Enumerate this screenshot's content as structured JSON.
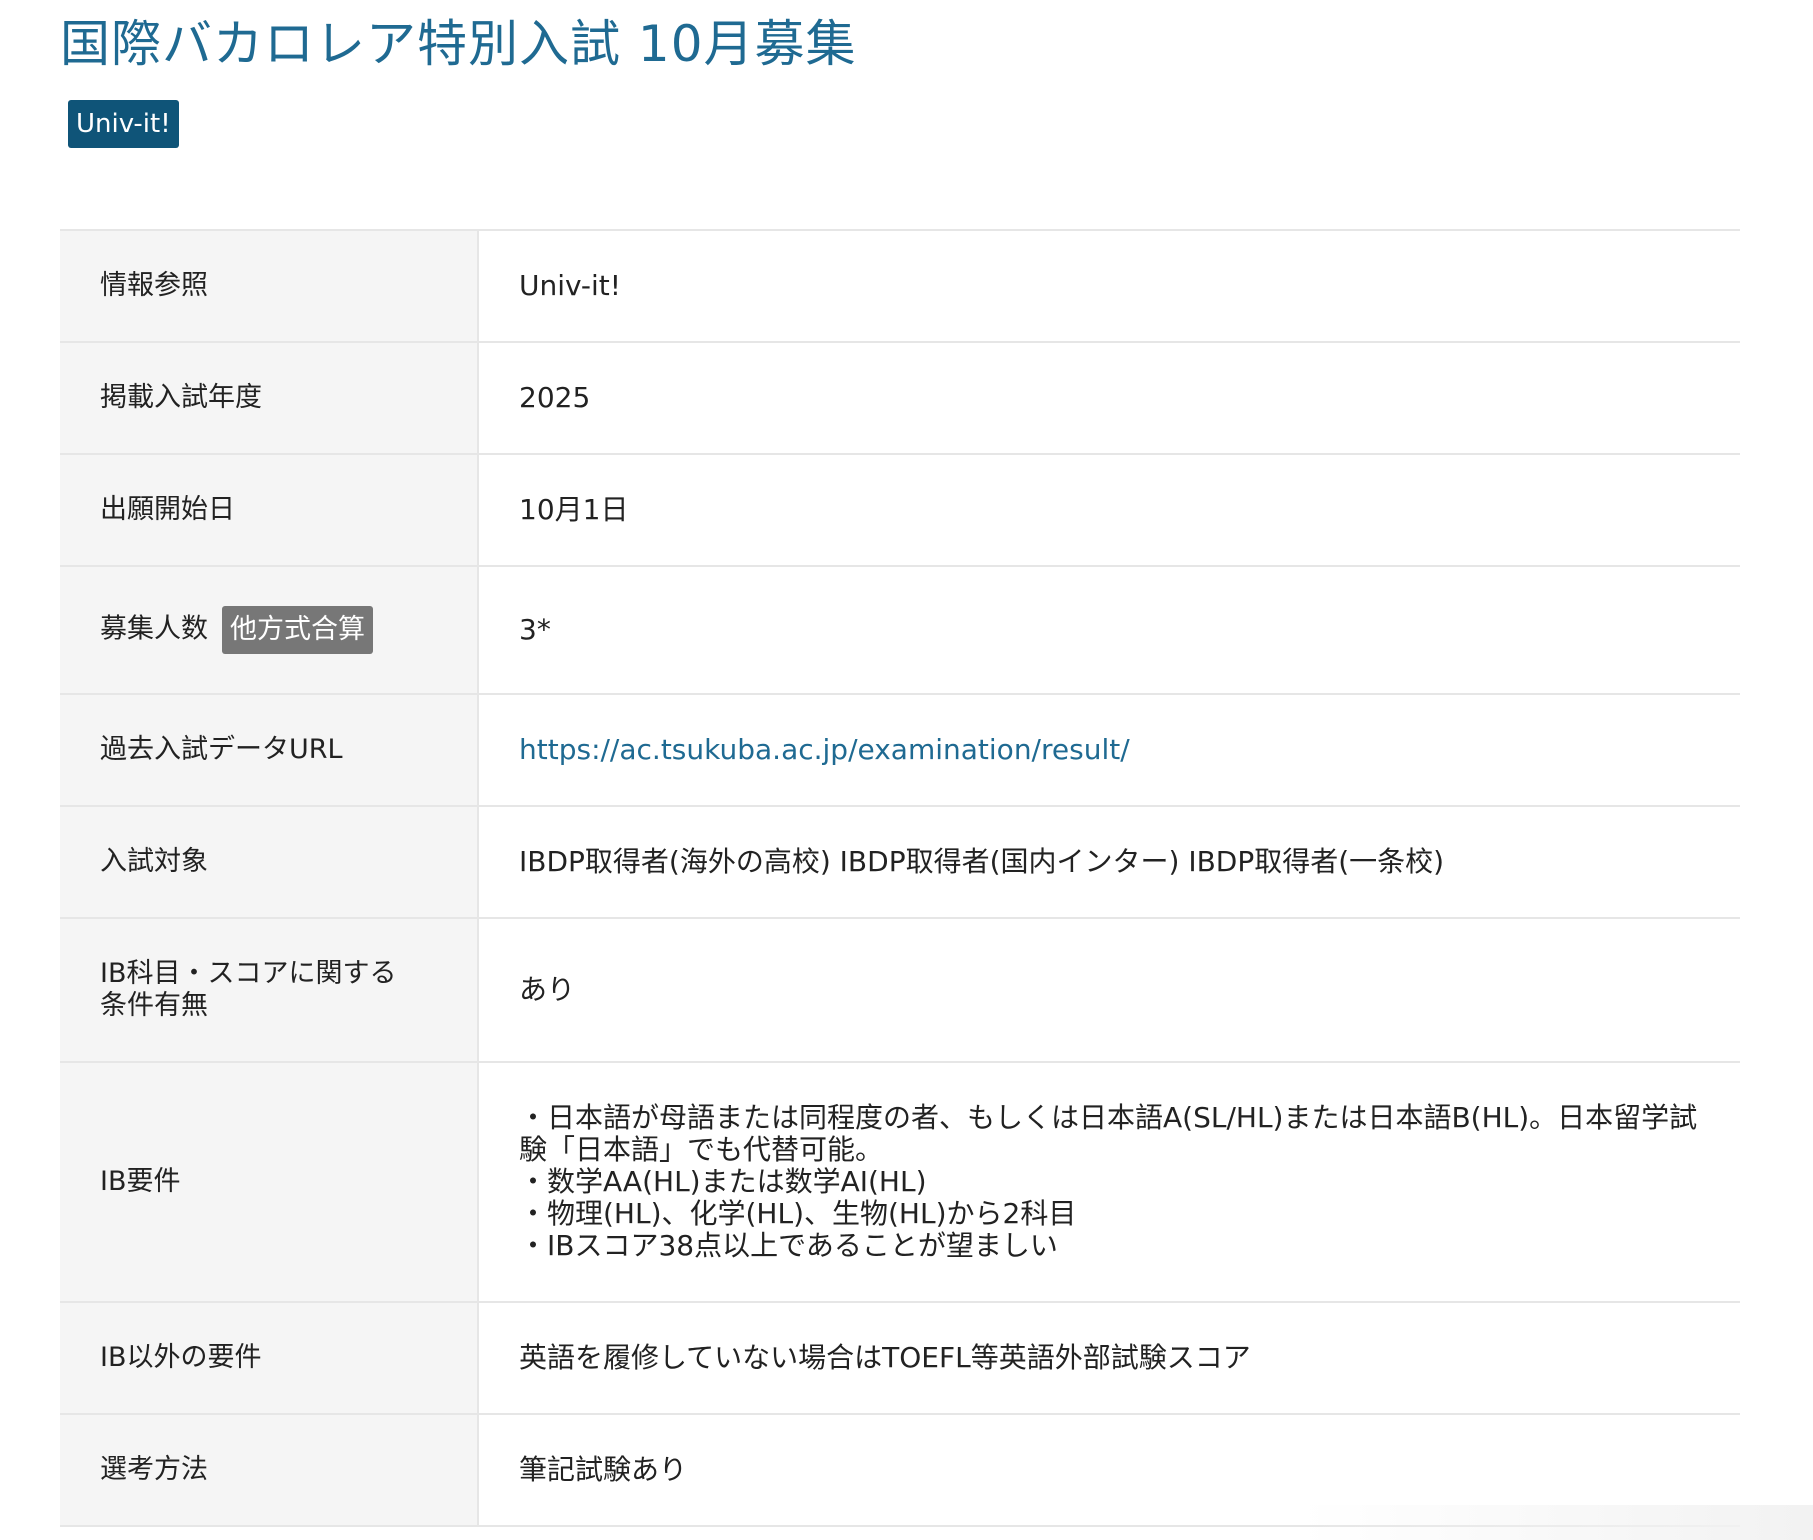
{
  "page": {
    "title": "国際バカロレア特別入試 10月募集",
    "source_badge": "Univ-it!"
  },
  "colors": {
    "title": "#1f6a92",
    "badge_bg": "#0f5478",
    "tag_bg": "#777777",
    "header_cell_bg": "#f5f5f5",
    "border": "#e6e6e6",
    "link": "#1f6a92"
  },
  "rows": {
    "reference": {
      "label": "情報参照",
      "value": "Univ-it!"
    },
    "year": {
      "label": "掲載入試年度",
      "value": "2025"
    },
    "start_date": {
      "label": "出願開始日",
      "value": "10月1日"
    },
    "capacity": {
      "label": "募集人数",
      "tag": "他方式合算",
      "value": "3*"
    },
    "past_data_url": {
      "label": "過去入試データURL",
      "value": "https://ac.tsukuba.ac.jp/examination/result/"
    },
    "target": {
      "label": "入試対象",
      "value": "IBDP取得者(海外の高校) IBDP取得者(国内インター) IBDP取得者(一条校)"
    },
    "ib_conditions": {
      "label_line1": "IB科目・スコアに関する",
      "label_line2": "条件有無",
      "value": "あり"
    },
    "ib_requirements": {
      "label": "IB要件",
      "lines": [
        "・日本語が母語または同程度の者、もしくは日本語A(SL/HL)または日本語B(HL)。日本留学試験「日本語」でも代替可能。",
        "・数学AA(HL)または数学AI(HL)",
        "・物理(HL)、化学(HL)、生物(HL)から2科目",
        "・IBスコア38点以上であることが望ましい"
      ]
    },
    "other_requirements": {
      "label": "IB以外の要件",
      "value": "英語を履修していない場合はTOEFL等英語外部試験スコア"
    },
    "selection": {
      "label": "選考方法",
      "value": "筆記試験あり"
    }
  }
}
